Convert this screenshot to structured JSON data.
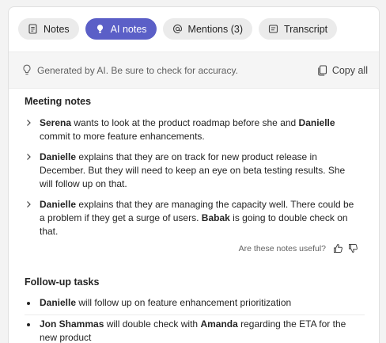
{
  "tabs": [
    {
      "label": "Notes",
      "icon": "notes-icon",
      "active": false
    },
    {
      "label": "AI notes",
      "icon": "lightbulb-icon",
      "active": true
    },
    {
      "label": "Mentions (3)",
      "icon": "at-icon",
      "active": false
    },
    {
      "label": "Transcript",
      "icon": "transcript-icon",
      "active": false
    }
  ],
  "info": {
    "disclaimer": "Generated by AI. Be sure to check for accuracy.",
    "copy_all": "Copy all"
  },
  "meeting_notes": {
    "title": "Meeting notes",
    "items": [
      {
        "parts": [
          {
            "b": "Serena"
          },
          {
            "t": " wants to look at the product roadmap before she and "
          },
          {
            "b": "Danielle"
          },
          {
            "t": " commit to more feature enhancements."
          }
        ]
      },
      {
        "parts": [
          {
            "b": "Danielle"
          },
          {
            "t": " explains that they are on track for new product release in December. But they will need to keep an eye on beta testing results. She will follow up on that."
          }
        ]
      },
      {
        "parts": [
          {
            "b": "Danielle"
          },
          {
            "t": " explains that they are managing the capacity well. There could be a problem if they get a surge of users. "
          },
          {
            "b": "Babak"
          },
          {
            "t": " is going to double check on that."
          }
        ]
      }
    ]
  },
  "feedback": {
    "question": "Are these notes useful?"
  },
  "follow_up": {
    "title": "Follow-up tasks",
    "items": [
      {
        "parts": [
          {
            "b": "Danielle"
          },
          {
            "t": " will follow up on feature enhancement prioritization"
          }
        ]
      },
      {
        "parts": [
          {
            "b": "Jon Shammas"
          },
          {
            "t": " will double check with "
          },
          {
            "b": "Amanda"
          },
          {
            "t": " regarding the ETA for the new product"
          }
        ]
      }
    ]
  },
  "colors": {
    "accent": "#5b5fc7",
    "tab_bg": "#ebebeb",
    "infobar_bg": "#f5f5f5"
  }
}
